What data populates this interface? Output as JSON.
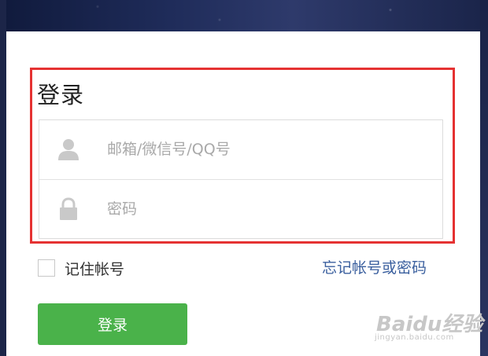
{
  "login": {
    "title": "登录",
    "username_placeholder": "邮箱/微信号/QQ号",
    "password_placeholder": "密码",
    "remember_label": "记住帐号",
    "forgot_link": "忘记帐号或密码",
    "submit_label": "登录"
  },
  "icons": {
    "user": "user-icon",
    "lock": "lock-icon"
  },
  "colors": {
    "highlight_border": "#e53232",
    "button": "#4ab24a",
    "link": "#3a5f9e",
    "placeholder": "#a9a9a9"
  },
  "watermark": {
    "brand": "Baidu经验",
    "url": "jingyan.baidu.com"
  }
}
